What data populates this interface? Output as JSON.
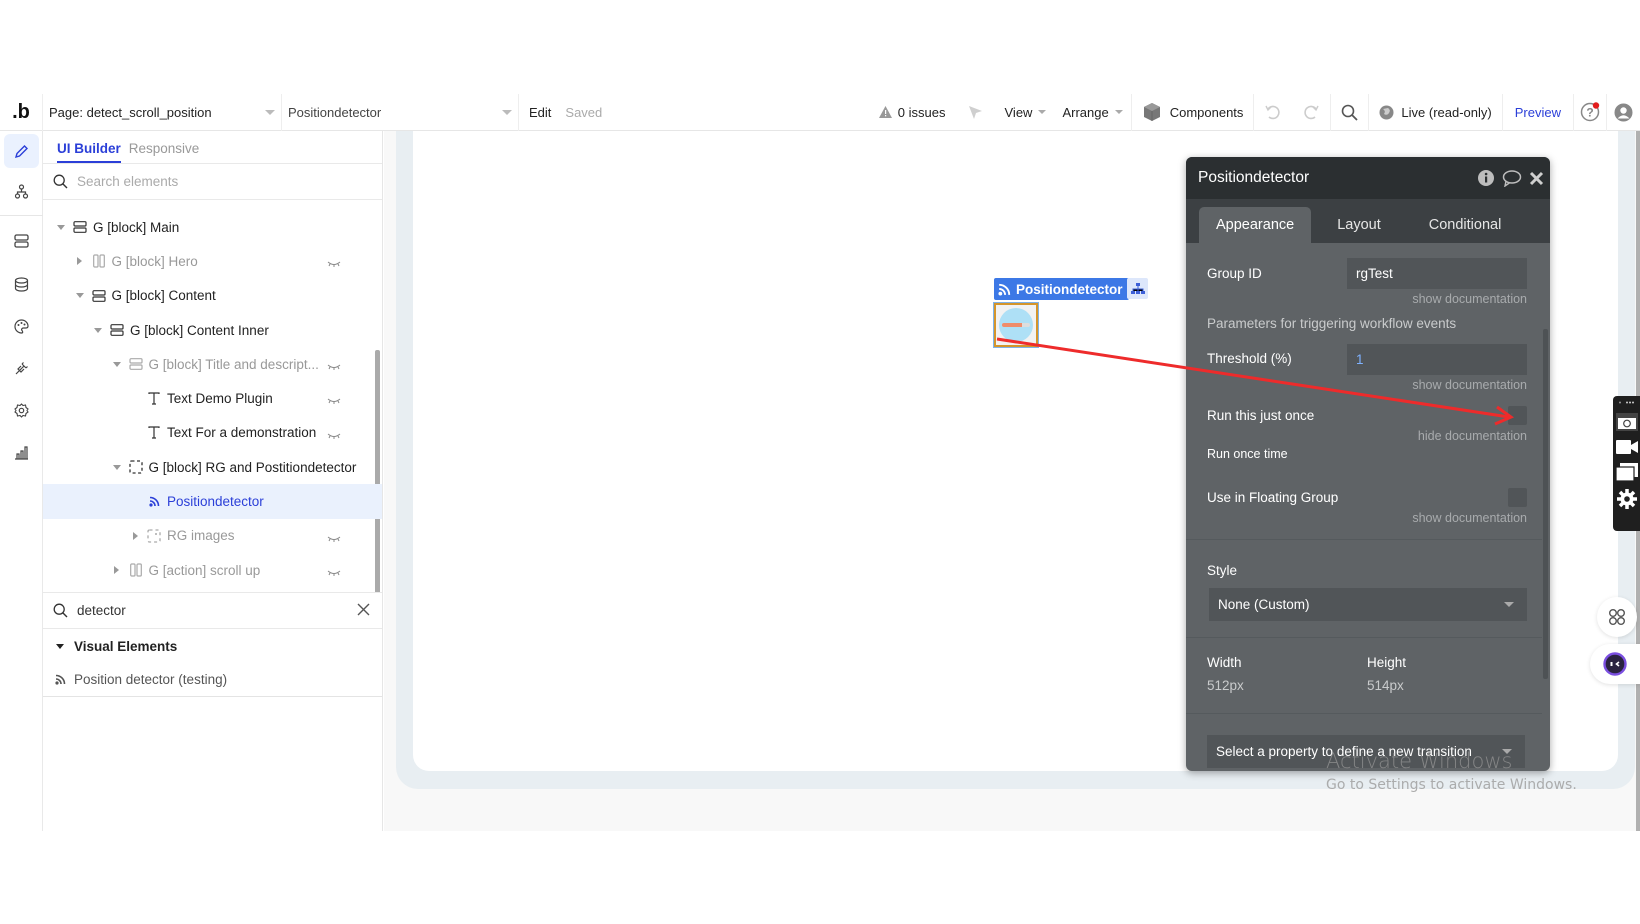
{
  "topbar": {
    "logo": ".b",
    "page_selector": "Page: detect_scroll_position",
    "element_selector": "Positiondetector",
    "edit_label": "Edit",
    "save_status": "Saved",
    "issues": "0 issues",
    "view_menu": "View",
    "arrange_menu": "Arrange",
    "components_label": "Components",
    "live_status": "Live (read-only)",
    "preview_label": "Preview"
  },
  "rail": {
    "items": [
      "design-pencil",
      "workflow-tree",
      "data-stack",
      "database",
      "styles-palette",
      "plugins",
      "settings-gear",
      "logs-chart"
    ]
  },
  "elements_panel": {
    "tabs": [
      {
        "label": "UI Builder",
        "active": true
      },
      {
        "label": "Responsive",
        "active": false
      }
    ],
    "search_placeholder": "Search elements",
    "tree": [
      {
        "label": "G [block] Main",
        "depth": 0,
        "toggle": "expanded",
        "icon": "group-rows-icon",
        "hidden": false,
        "selected": false
      },
      {
        "label": "G [block] Hero",
        "depth": 1,
        "toggle": "collapsed",
        "icon": "group-columns-icon",
        "hidden": true,
        "selected": false
      },
      {
        "label": "G [block] Content",
        "depth": 1,
        "toggle": "expanded",
        "icon": "group-rows-icon",
        "hidden": false,
        "selected": false
      },
      {
        "label": "G [block] Content Inner",
        "depth": 2,
        "toggle": "expanded",
        "icon": "group-rows-icon",
        "hidden": false,
        "selected": false
      },
      {
        "label": "G [block] Title and descript...",
        "depth": 3,
        "toggle": "expanded",
        "icon": "group-rows-icon",
        "hidden": true,
        "selected": false
      },
      {
        "label": "Text Demo Plugin",
        "depth": 4,
        "toggle": "none",
        "icon": "text-icon",
        "hidden": false,
        "eye": true,
        "selected": false
      },
      {
        "label": "Text For a demonstration",
        "depth": 4,
        "toggle": "none",
        "icon": "text-icon",
        "hidden": false,
        "eye": true,
        "selected": false
      },
      {
        "label": "G [block] RG and Postitiondetector",
        "depth": 3,
        "toggle": "expanded",
        "icon": "group-dashed-icon",
        "hidden": false,
        "selected": false
      },
      {
        "label": "Positiondetector",
        "depth": 4,
        "toggle": "none",
        "icon": "rss-icon",
        "hidden": false,
        "selected": true
      },
      {
        "label": "RG images",
        "depth": 4,
        "toggle": "collapsed",
        "icon": "repeating-group-icon",
        "hidden": true,
        "selected": false
      },
      {
        "label": "G [action] scroll up",
        "depth": 3,
        "toggle": "collapsed",
        "icon": "group-columns-icon",
        "hidden": true,
        "selected": false
      }
    ],
    "filter_value": "detector",
    "results_section": "Visual Elements",
    "results": [
      {
        "label": "Position detector (testing)",
        "icon": "rss-icon"
      }
    ]
  },
  "canvas": {
    "element_badge": "Positiondetector",
    "progress_fill": 0.7
  },
  "property_editor": {
    "title": "Positiondetector",
    "tabs": [
      {
        "label": "Appearance",
        "active": true
      },
      {
        "label": "Layout",
        "active": false
      },
      {
        "label": "Conditional",
        "active": false
      }
    ],
    "group_id_label": "Group ID",
    "group_id_value": "rgTest",
    "show_doc": "show documentation",
    "hide_doc": "hide documentation",
    "params_heading": "Parameters for triggering workflow events",
    "threshold_label": "Threshold (%)",
    "threshold_value": "1",
    "run_once_label": "Run this just once",
    "run_once_checked": false,
    "run_once_doc": "Run once time",
    "floating_label": "Use in Floating Group",
    "floating_checked": false,
    "style_label": "Style",
    "style_value": "None (Custom)",
    "width_label": "Width",
    "width_value": "512px",
    "height_label": "Height",
    "height_value": "514px",
    "transition_placeholder": "Select a property to define a new transition"
  },
  "watermark": {
    "line1": "Activate Windows",
    "line2": "Go to Settings to activate Windows."
  },
  "colors": {
    "accent": "#2b3fd8",
    "badge": "#3c78e6",
    "panel_bg": "#5f6366",
    "panel_header": "#2b2f31",
    "annotation_arrow": "#ee2b2b"
  }
}
